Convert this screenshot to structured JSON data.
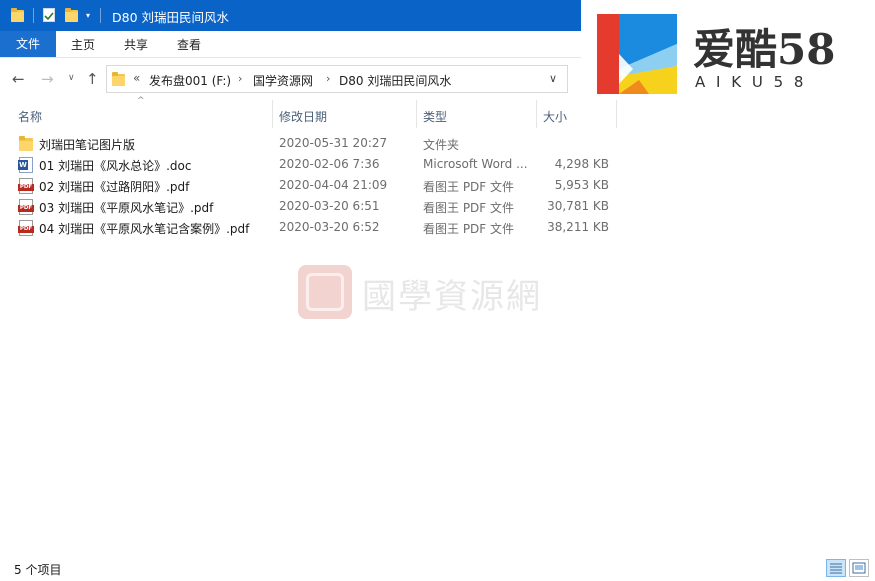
{
  "window": {
    "title": "D80 刘瑞田民间风水"
  },
  "ribbon": {
    "tabs": [
      "文件",
      "主页",
      "共享",
      "查看"
    ]
  },
  "address": {
    "overflow": "«",
    "crumbs": [
      "发布盘001 (F:)",
      "国学资源网",
      "D80 刘瑞田民间风水"
    ]
  },
  "columns": {
    "name": "名称",
    "date": "修改日期",
    "type": "类型",
    "size": "大小"
  },
  "files": [
    {
      "icon": "folder-icon",
      "name": "刘瑞田笔记图片版",
      "date": "2020-05-31 20:27",
      "type": "文件夹",
      "size": ""
    },
    {
      "icon": "word-doc-icon",
      "name": "01 刘瑞田《风水总论》.doc",
      "date": "2020-02-06 7:36",
      "type": "Microsoft Word ...",
      "size": "4,298 KB"
    },
    {
      "icon": "pdf-icon",
      "name": "02 刘瑞田《过路阴阳》.pdf",
      "date": "2020-04-04 21:09",
      "type": "看图王 PDF 文件",
      "size": "5,953 KB"
    },
    {
      "icon": "pdf-icon",
      "name": "03 刘瑞田《平原风水笔记》.pdf",
      "date": "2020-03-20 6:51",
      "type": "看图王 PDF 文件",
      "size": "30,781 KB"
    },
    {
      "icon": "pdf-icon",
      "name": "04 刘瑞田《平原风水笔记含案例》.pdf",
      "date": "2020-03-20 6:52",
      "type": "看图王 PDF 文件",
      "size": "38,211 KB"
    }
  ],
  "status": {
    "count": "5 个项目"
  },
  "logo": {
    "title": "爱酷58",
    "subtitle": "A I K U 5 8"
  },
  "watermark": {
    "text": "國學資源網"
  },
  "colors": {
    "titlebar": "#0a64c8",
    "file_tab": "#1a6fcf",
    "pdf_label": "#b72a1f",
    "word_label": "#2b579a",
    "folder": "#f3c74c"
  }
}
